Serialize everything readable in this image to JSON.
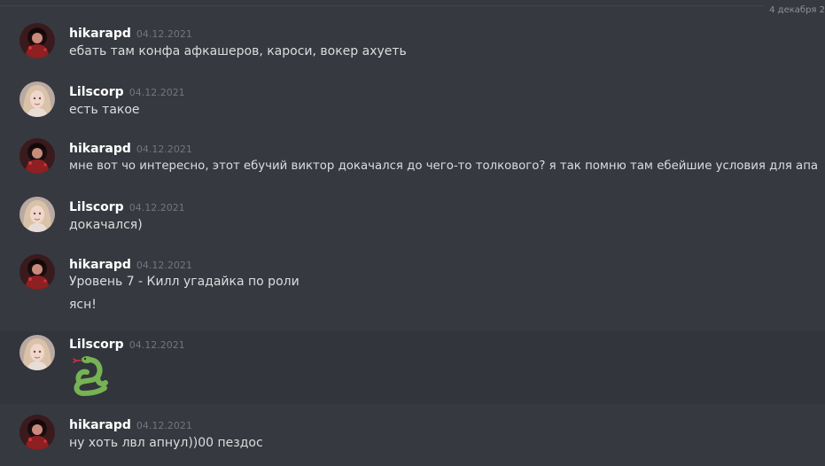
{
  "divider": {
    "date": "4 декабря 2"
  },
  "messages": [
    {
      "author": "hikarapd",
      "time": "04.12.2021",
      "lines": [
        "ебать там конфа афкашеров, кароси, вокер ахуеть"
      ]
    },
    {
      "author": "Lilscorp",
      "time": "04.12.2021",
      "lines": [
        "есть такое"
      ]
    },
    {
      "author": "hikarapd",
      "time": "04.12.2021",
      "lines": [
        "мне вот чо интересно, этот ебучий виктор докачался до чего-то толкового? я так помню там ебейшие условия для апа"
      ]
    },
    {
      "author": "Lilscorp",
      "time": "04.12.2021",
      "lines": [
        "докачался)"
      ]
    },
    {
      "author": "hikarapd",
      "time": "04.12.2021",
      "lines": [
        "Уровень 7 - Килл угадайка по роли",
        "ясн!"
      ]
    },
    {
      "author": "Lilscorp",
      "time": "04.12.2021",
      "emoji": "snake-emoji"
    },
    {
      "author": "hikarapd",
      "time": "04.12.2021",
      "lines": [
        "ну хоть лвл апнул))00  пездос"
      ]
    }
  ],
  "colors": {
    "background": "#36393f",
    "hover_background": "#32353b",
    "username": "#ffffff",
    "text": "#dcddde",
    "timestamp": "#72767d",
    "emoji_snake": "#77b255"
  }
}
